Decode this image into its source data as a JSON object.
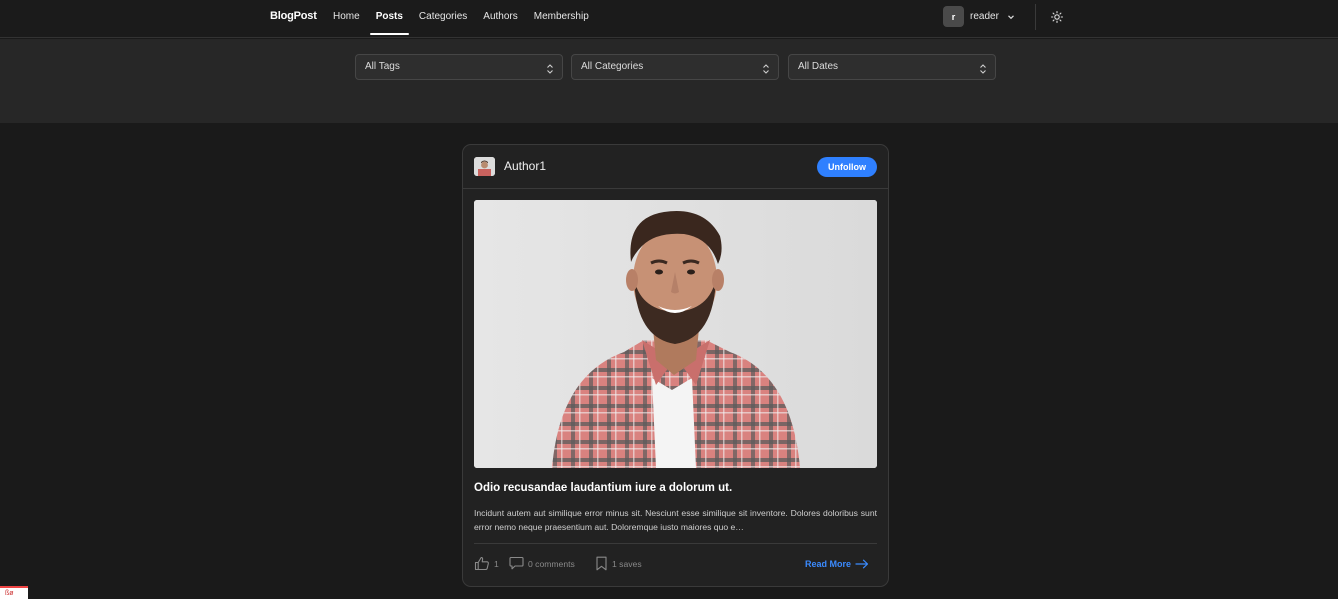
{
  "nav": {
    "brand": "BlogPost",
    "links": [
      "Home",
      "Posts",
      "Categories",
      "Authors",
      "Membership"
    ],
    "active": "Posts",
    "user": {
      "initial": "r",
      "name": "reader"
    }
  },
  "filters": {
    "tags": "All Tags",
    "categories": "All Categories",
    "dates": "All Dates"
  },
  "post": {
    "author": "Author1",
    "follow_label": "Unfollow",
    "title": "Odio recusandae laudantium iure a dolorum ut.",
    "excerpt": "Incidunt autem aut similique error minus sit. Nesciunt esse similique sit inventore. Dolores doloribus sunt error nemo neque praesentium aut. Doloremque iusto maiores quo e…",
    "likes": "1",
    "comments": "0 comments",
    "saves": "1 saves",
    "read_more": "Read More"
  },
  "colors": {
    "accent": "#2f80ff",
    "link": "#3b8bff",
    "background": "#1a1a1a",
    "card": "#222222"
  },
  "icons": {
    "user_chevron": "chevron-down-icon",
    "theme": "sun-icon",
    "select": "up-down-chevron-icon",
    "like": "thumbs-up-icon",
    "comment": "comment-icon",
    "save": "bookmark-icon",
    "read_more": "arrow-right-icon"
  }
}
